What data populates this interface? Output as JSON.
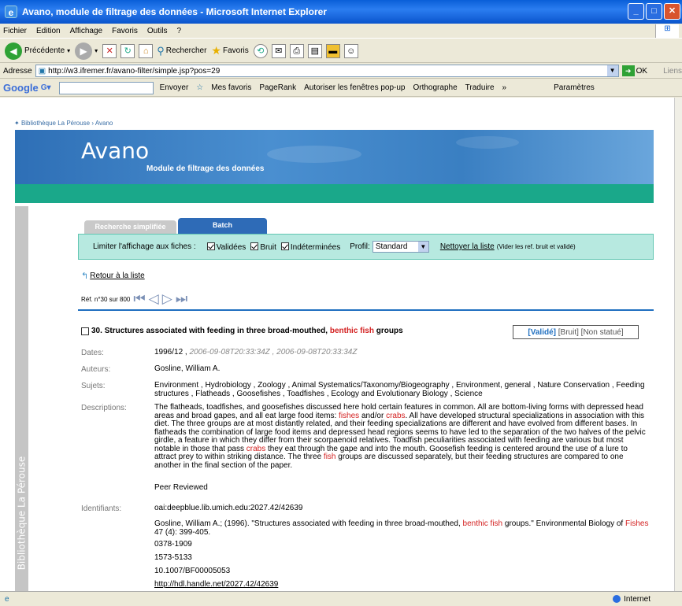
{
  "window": {
    "title": "Avano, module de filtrage des données - Microsoft Internet Explorer"
  },
  "menu": [
    "Fichier",
    "Edition",
    "Affichage",
    "Favoris",
    "Outils",
    "?"
  ],
  "toolbar": {
    "back": "Précédente",
    "search": "Rechercher",
    "favorites": "Favoris"
  },
  "address": {
    "label": "Adresse",
    "url": "http://w3.ifremer.fr/avano-filter/simple.jsp?pos=29",
    "go": "OK",
    "links": "Liens"
  },
  "googlebar": {
    "logo": "Google",
    "envoyer": "Envoyer",
    "favoris": "Mes favoris",
    "pagerank": "PageRank",
    "popups": "Autoriser les fenêtres pop-up",
    "spell": "Orthographe",
    "translate": "Traduire",
    "settings": "Paramètres"
  },
  "page": {
    "breadcrumb": [
      "Bibliothèque La Pérouse",
      "Avano"
    ],
    "banner_title": "Avano",
    "banner_subtitle": "Module de filtrage des données",
    "side_text": "Bibliothèque La Pérouse",
    "tabs": [
      "Recherche simplifiée",
      "Batch"
    ],
    "filter": {
      "label": "Limiter l'affichage aux fiches :",
      "opt1": "Validées",
      "opt2": "Bruit",
      "opt3": "Indéterminées",
      "profil_label": "Profil:",
      "profil_value": "Standard",
      "clean_link": "Nettoyer la liste",
      "clean_note": "(Vider les ref. bruit et validé)"
    },
    "back_link": "Retour à la liste",
    "ref_text": "Réf. n°30 sur 800",
    "item": {
      "number": "30.",
      "title_pre": "Structures associated with feeding in three broad-mouthed,",
      "title_hl": "benthic fish",
      "title_post": "groups",
      "status_valid": "[Validé]",
      "status_noise": "[Bruit]",
      "status_none": "[Non statué]",
      "dates_label": "Dates:",
      "dates_main": "1996/12 ,",
      "dates_rest": "2006-09-08T20:33:34Z , 2006-09-08T20:33:34Z",
      "authors_label": "Auteurs:",
      "authors": "Gosline, William A.",
      "subjects_label": "Sujets:",
      "subjects": "Environment , Hydrobiology , Zoology , Animal Systematics/Taxonomy/Biogeography , Environment, general , Nature Conservation , Feeding structures , Flatheads , Goosefishes , Toadfishes , Ecology and Evolutionary Biology , Science",
      "desc_label": "Descriptions:",
      "desc_1": "The flatheads, toadfishes, and goosefishes discussed here hold certain features in common. All are bottom-living forms with depressed head areas and broad gapes, and all eat large food items:",
      "desc_hl1": "fishes",
      "desc_2": "and/or",
      "desc_hl2": "crabs",
      "desc_3": ". All have developed structural specializations in association with this diet. The three groups are at most distantly related, and their feeding specializations are different and have evolved from different bases. In flatheads the combination of large food items and depressed head regions seems to have led to the separation of the two halves of the pelvic girdle, a feature in which they differ from their scorpaenoid relatives. Toadfish peculiarities associated with feeding are various but most notable in those that pass",
      "desc_hl3": "crabs",
      "desc_4": "they eat through the gape and into the mouth. Goosefish feeding is centered around the use of a lure to attract prey to within striking distance. The three",
      "desc_hl4": "fish",
      "desc_5": "groups are discussed separately, but their feeding structures are compared to one another in the final section of the paper.",
      "peer": "Peer Reviewed",
      "ident_label": "Identifiants:",
      "ident_1": "oai:deepblue.lib.umich.edu:2027.42/42639",
      "cit_1": "Gosline, William A.; (1996). \"Structures associated with feeding in three broad-mouthed,",
      "cit_hl1": "benthic fish",
      "cit_2": "groups.\" Environmental Biology of",
      "cit_hl2": "Fishes",
      "cit_3": "47 (4): 399-405.",
      "issn1": "0378-1909",
      "issn2": "1573-5133",
      "doi": "10.1007/BF00005053",
      "handle": "http://hdl.handle.net/2027.42/42639"
    }
  },
  "status": {
    "zone": "Internet"
  }
}
